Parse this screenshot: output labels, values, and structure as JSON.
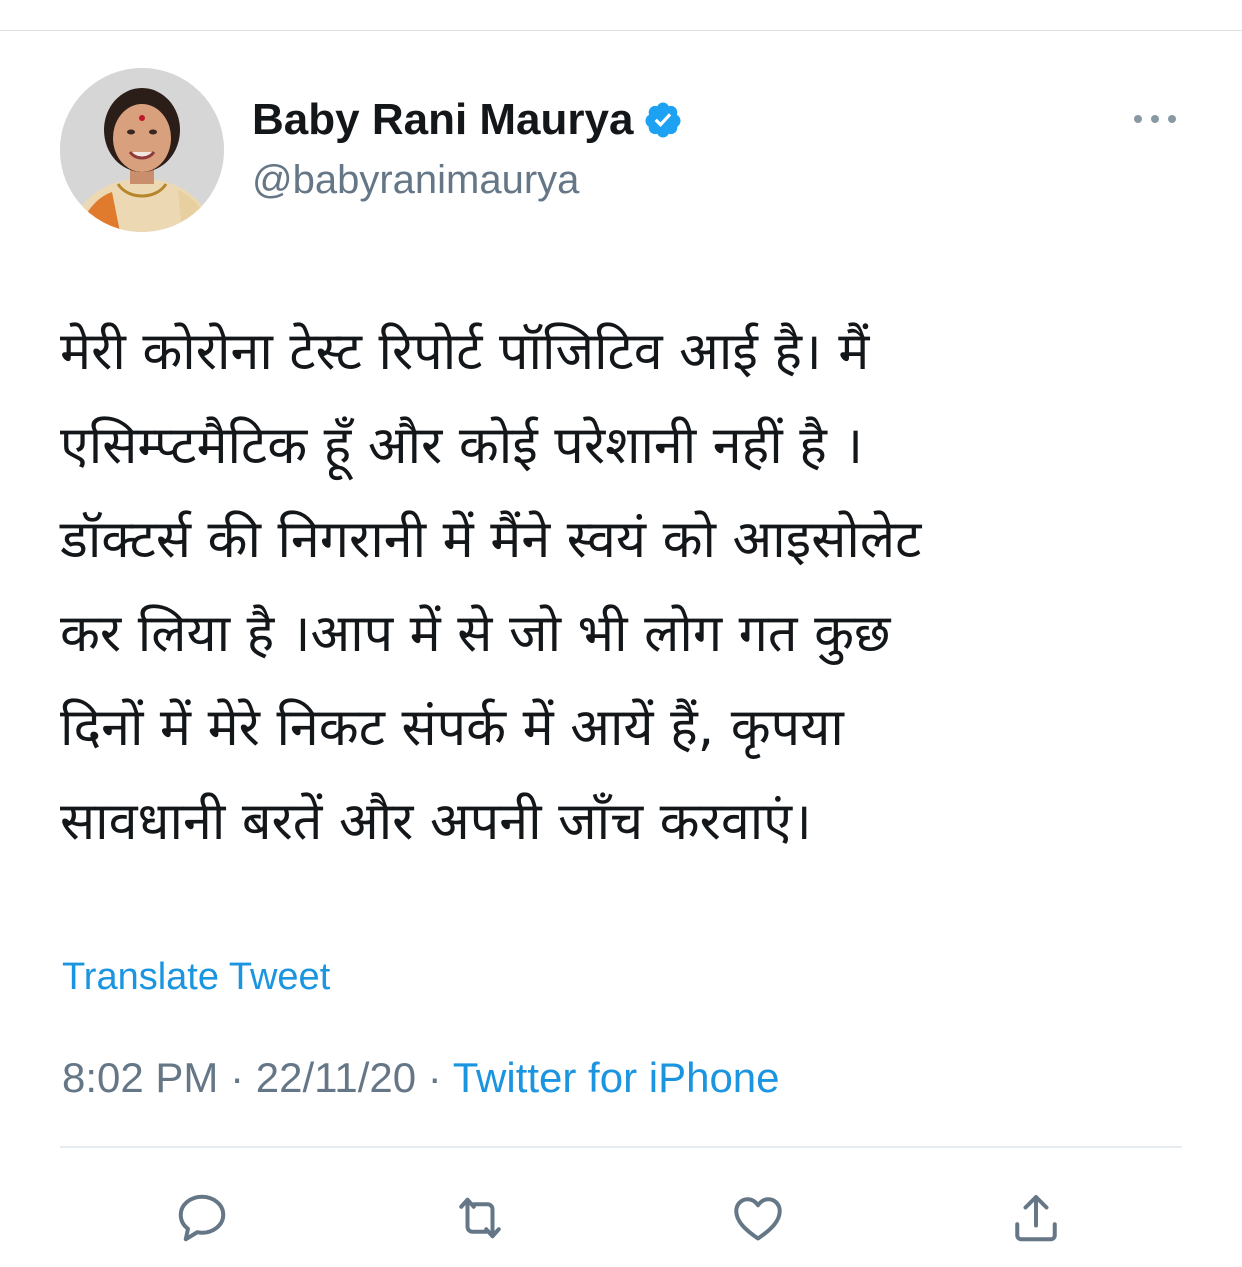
{
  "tweet": {
    "display_name": "Baby Rani Maurya",
    "handle": "@babyranimaurya",
    "verified": true,
    "text_lines": [
      "मेरी कोरोना टेस्ट रिपोर्ट पॉजिटिव आई है। मैं",
      "एसिम्प्टमैटिक हूँ और कोई परेशानी नहीं है ।",
      "डॉक्टर्स की निगरानी में मैंने स्वयं को आइसोलेट",
      "कर लिया है ।आप में से जो भी लोग गत कुछ",
      "दिनों में मेरे निकट संपर्क में आयें हैं, कृपया",
      "सावधानी बरतें और अपनी जाँच करवाएं।"
    ],
    "translate_label": "Translate Tweet",
    "time": "8:02 PM",
    "separator": " · ",
    "date": "22/11/20",
    "source": "Twitter for iPhone"
  },
  "icons": {
    "more": "more-icon",
    "verified": "verified-badge-icon",
    "reply": "reply-icon",
    "retweet": "retweet-icon",
    "like": "like-icon",
    "share": "share-icon"
  },
  "colors": {
    "link": "#1b95e0",
    "secondary_text": "#657786",
    "primary_text": "#14171a",
    "verified": "#1da1f2"
  }
}
